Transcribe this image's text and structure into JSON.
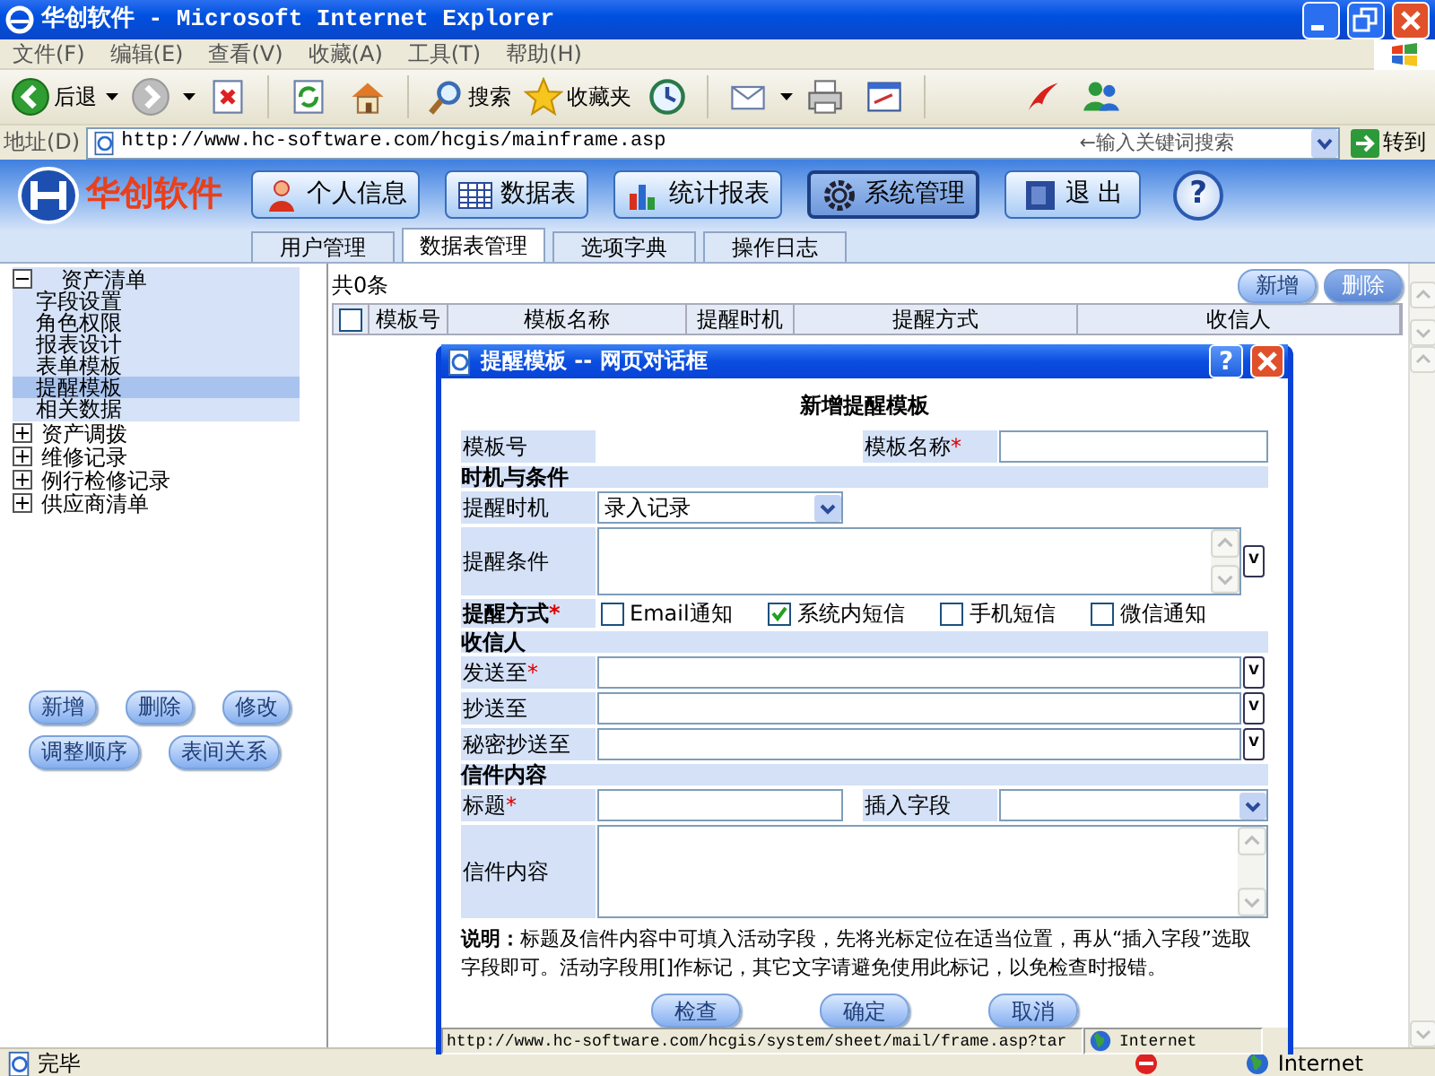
{
  "window": {
    "title": "华创软件 - Microsoft Internet Explorer"
  },
  "menu": [
    "文件(F)",
    "编辑(E)",
    "查看(V)",
    "收藏(A)",
    "工具(T)",
    "帮助(H)"
  ],
  "toolbar": [
    {
      "kind": "back",
      "label": "后退",
      "caret": true
    },
    {
      "kind": "forward",
      "caret": true
    },
    {
      "kind": "stop"
    },
    {
      "kind": "refresh"
    },
    {
      "kind": "home"
    },
    {
      "kind": "search",
      "label": "搜索"
    },
    {
      "kind": "favorites",
      "label": "收藏夹"
    },
    {
      "kind": "history"
    },
    {
      "kind": "mail",
      "caret": true
    },
    {
      "kind": "print"
    },
    {
      "kind": "edit"
    },
    {
      "kind": "bird"
    },
    {
      "kind": "people"
    }
  ],
  "address": {
    "label": "地址(D)",
    "url": "http://www.hc-software.com/hcgis/mainframe.asp",
    "search_placeholder": "←输入关键词搜索",
    "go": "转到"
  },
  "app": {
    "logo": "华创软件",
    "help": "?",
    "nav": [
      {
        "kind": "person",
        "label": "个人信息",
        "selected": false
      },
      {
        "kind": "table",
        "label": "数据表",
        "selected": false
      },
      {
        "kind": "chart",
        "label": "统计报表",
        "selected": false
      },
      {
        "kind": "gear",
        "label": "系统管理",
        "selected": true
      },
      {
        "kind": "exit",
        "label": "退 出",
        "selected": false
      }
    ]
  },
  "tabs": [
    {
      "label": "用户管理",
      "selected": false
    },
    {
      "label": "数据表管理",
      "selected": true
    },
    {
      "label": "选项字典",
      "selected": false
    },
    {
      "label": "操作日志",
      "selected": false
    }
  ],
  "tree": [
    {
      "label": "资产清单",
      "expanded": true,
      "children": [
        {
          "label": "字段设置",
          "selected": false
        },
        {
          "label": "角色权限",
          "selected": false
        },
        {
          "label": "报表设计",
          "selected": false
        },
        {
          "label": "表单模板",
          "selected": false
        },
        {
          "label": "提醒模板",
          "selected": true
        },
        {
          "label": "相关数据",
          "selected": false
        }
      ]
    },
    {
      "label": "资产调拨",
      "expanded": false
    },
    {
      "label": "维修记录",
      "expanded": false
    },
    {
      "label": "例行检修记录",
      "expanded": false
    },
    {
      "label": "供应商清单",
      "expanded": false
    }
  ],
  "sidebar_buttons": [
    [
      "新增",
      "删除",
      "修改"
    ],
    [
      "调整顺序",
      "表间关系"
    ]
  ],
  "grid": {
    "count": "共0条",
    "buttons": [
      {
        "label": "新增",
        "disabled": false
      },
      {
        "label": "删除",
        "disabled": true
      }
    ],
    "select_all": {
      "checked": false
    },
    "columns": [
      "模板号",
      "模板名称",
      "提醒时机",
      "提醒方式",
      "收信人"
    ]
  },
  "dialog": {
    "title": "提醒模板 -- 网页对话框",
    "help": "?",
    "heading": "新增提醒模板",
    "rows": [
      {
        "kind": "id_name",
        "label": "模板号",
        "label2": "模板名称",
        "mark2": "*"
      },
      {
        "kind": "section",
        "label": "时机与条件"
      },
      {
        "kind": "select",
        "label": "提醒时机",
        "value": "录入记录"
      },
      {
        "kind": "textarea",
        "label": "提醒条件",
        "picker": "v"
      },
      {
        "kind": "checks",
        "label": "提醒方式",
        "mark": "*",
        "bold": true,
        "options": [
          {
            "label": "Email通知",
            "checked": false
          },
          {
            "label": "系统内短信",
            "checked": true
          },
          {
            "label": "手机短信",
            "checked": false
          },
          {
            "label": "微信通知",
            "checked": false
          }
        ]
      },
      {
        "kind": "section",
        "label": "收信人"
      },
      {
        "kind": "input",
        "label": "发送至",
        "mark": "*",
        "picker": "v"
      },
      {
        "kind": "input",
        "label": "抄送至",
        "picker": "v"
      },
      {
        "kind": "input",
        "label": "秘密抄送至",
        "picker": "v"
      },
      {
        "kind": "section",
        "label": "信件内容"
      },
      {
        "kind": "subject",
        "label": "标题",
        "mark": "*",
        "label2": "插入字段"
      },
      {
        "kind": "textarea",
        "label": "信件内容"
      }
    ],
    "note": "**说明：**标题及信件内容中可填入活动字段，先将光标定位在适当位置，再从“插入字段”选取字段即可。活动字段用[]作标记，其它文字请避免使用此标记，以免检查时报错。",
    "buttons": [
      "检查",
      "确定",
      "取消"
    ],
    "status": {
      "url": "http://www.hc-software.com/hcgis/system/sheet/mail/frame.asp?tar",
      "zone": "Internet"
    }
  },
  "status_bar": {
    "text": "完毕",
    "zone": "Internet"
  }
}
